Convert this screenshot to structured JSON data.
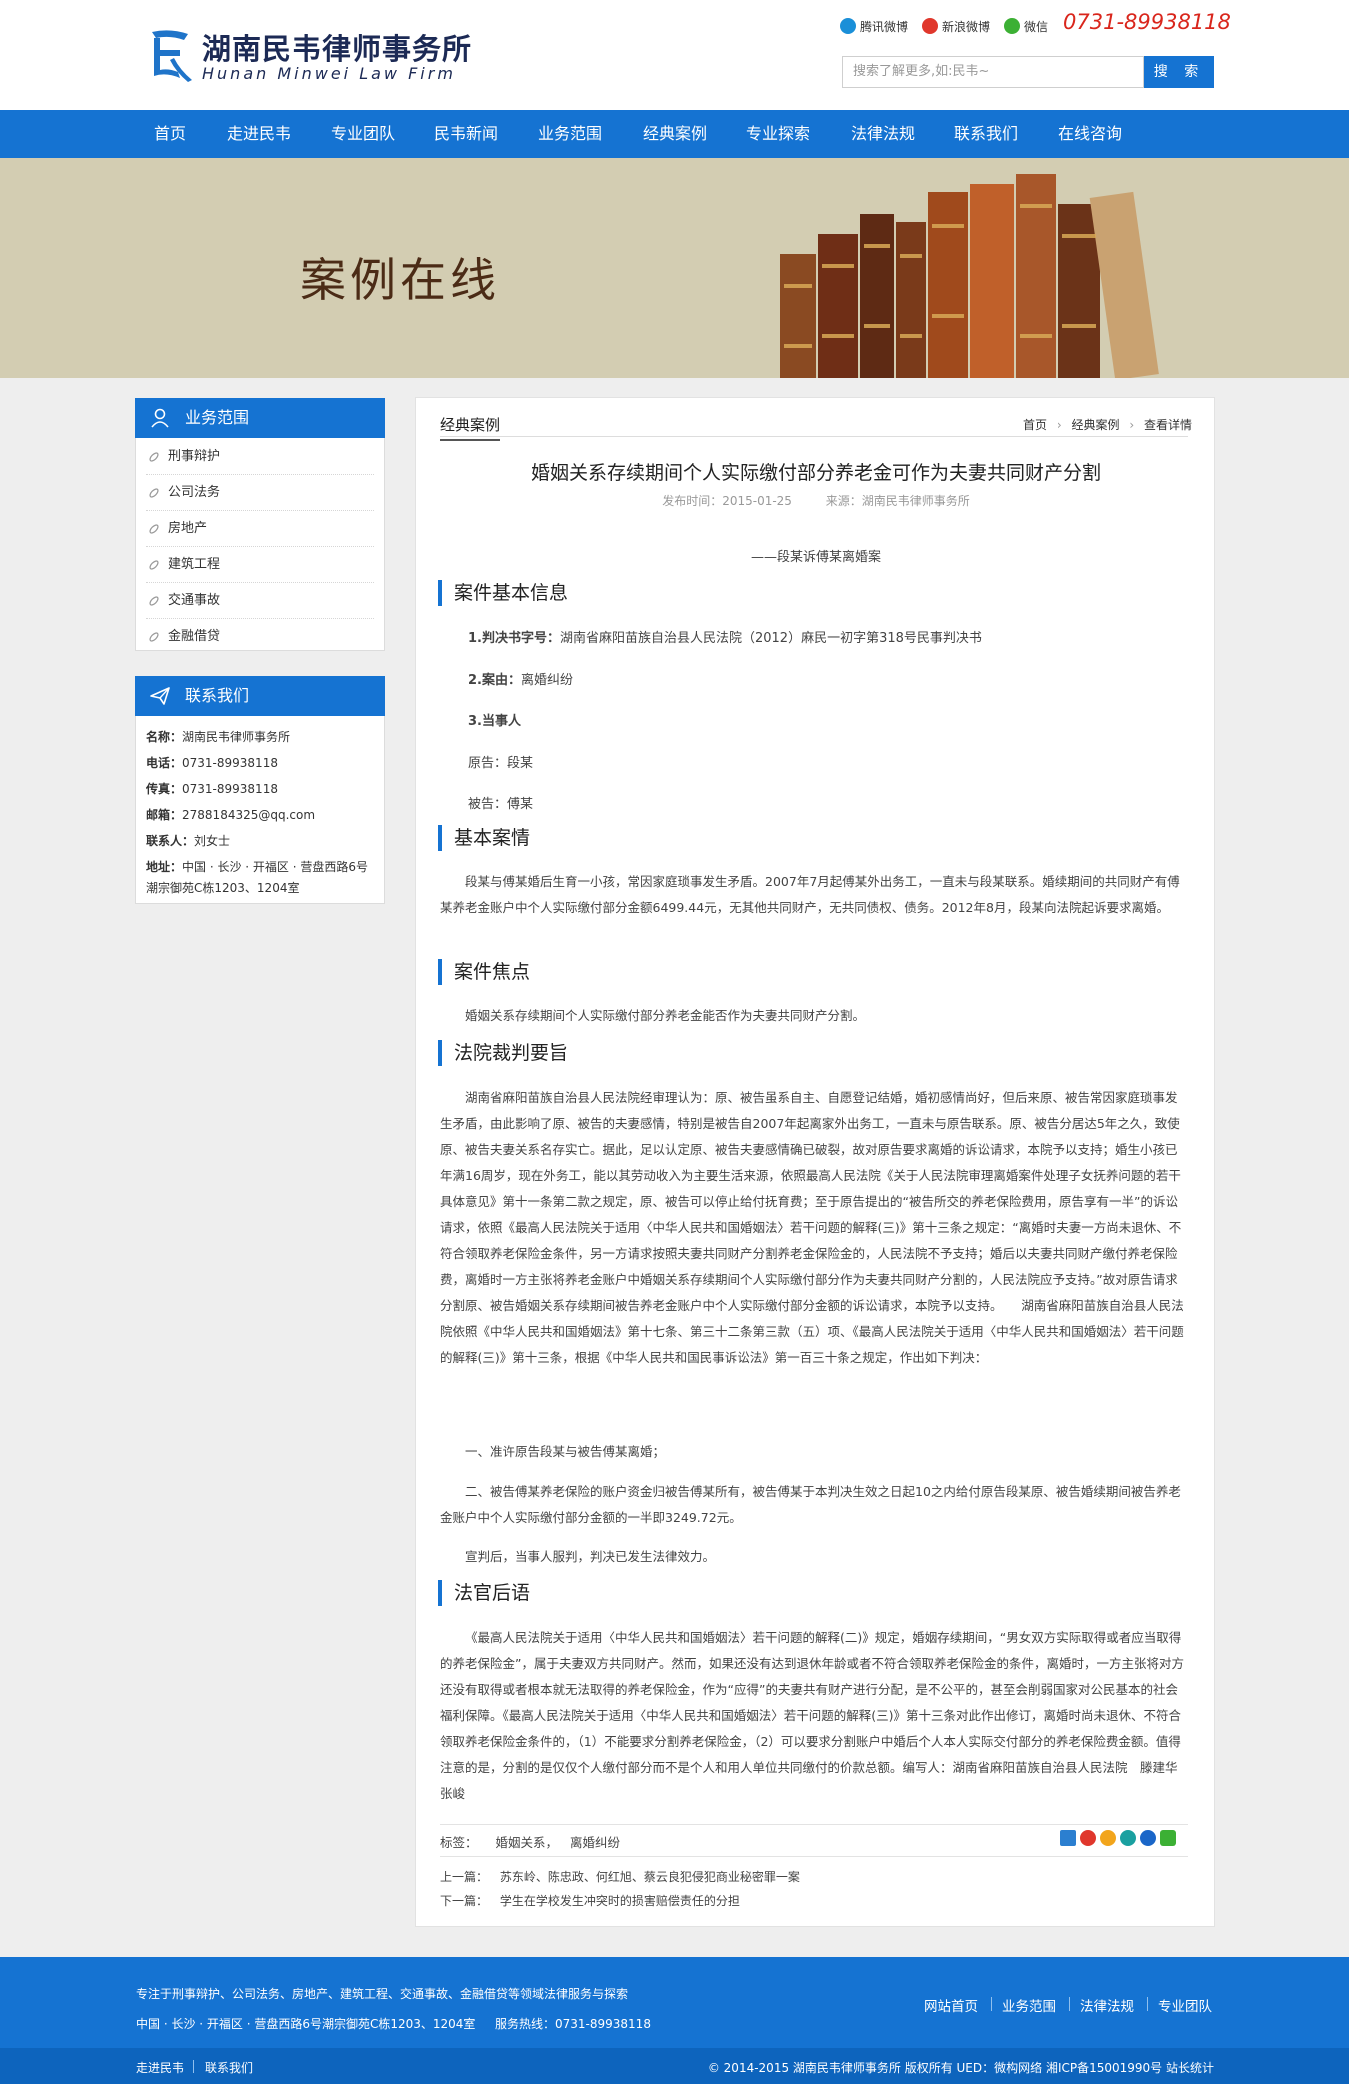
{
  "header": {
    "logo_cn": "湖南民韦律师事务所",
    "logo_en": "Hunan Minwei Law Firm",
    "social": [
      {
        "label": "腾讯微博",
        "icon": "tencent-weibo-icon",
        "color": "#1a8fd8"
      },
      {
        "label": "新浪微博",
        "icon": "sina-weibo-icon",
        "color": "#e0372c"
      },
      {
        "label": "微信",
        "icon": "wechat-icon",
        "color": "#3cb034"
      }
    ],
    "phone": "0731-89938118",
    "search_placeholder": "搜索了解更多,如:民韦~",
    "search_button": "搜 索"
  },
  "nav": [
    "首页",
    "走进民韦",
    "专业团队",
    "民韦新闻",
    "业务范围",
    "经典案例",
    "专业探索",
    "法律法规",
    "联系我们",
    "在线咨询"
  ],
  "banner": {
    "title": "案例在线"
  },
  "sidebar": {
    "categories_title": "业务范围",
    "categories": [
      "刑事辩护",
      "公司法务",
      "房地产",
      "建筑工程",
      "交通事故",
      "金融借贷"
    ],
    "contact_title": "联系我们",
    "contact": [
      {
        "label": "名称：",
        "value": "湖南民韦律师事务所"
      },
      {
        "label": "电话：",
        "value": "0731-89938118"
      },
      {
        "label": "传真：",
        "value": "0731-89938118"
      },
      {
        "label": "邮箱：",
        "value": "2788184325@qq.com"
      },
      {
        "label": "联系人：",
        "value": "刘女士"
      },
      {
        "label": "地址：",
        "value": "中国 · 长沙 · 开福区 · 营盘西路6号"
      }
    ],
    "contact_address_2": "潮宗御苑C栋1203、1204室"
  },
  "article": {
    "section": "经典案例",
    "breadcrumb": [
      "首页",
      "经典案例",
      "查看详情"
    ],
    "title": "婚姻关系存续期间个人实际缴付部分养老金可作为夫妻共同财产分割",
    "publish": "发布时间：2015-01-25",
    "source": "来源：湖南民韦律师事务所",
    "subtitle": "——段某诉傅某离婚案",
    "headings": [
      "案件基本信息",
      "基本案情",
      "案件焦点",
      "法院裁判要旨",
      "法官后语"
    ],
    "info": [
      {
        "label": "1.判决书字号：",
        "value": "湖南省麻阳苗族自治县人民法院（2012）麻民一初字第318号民事判决书"
      },
      {
        "label": "2.案由：",
        "value": "离婚纠纷"
      },
      {
        "label": "3.当事人",
        "value": ""
      }
    ],
    "plaintiff": "原告：段某",
    "defendant": "被告：傅某",
    "facts": "段某与傅某婚后生育一小孩，常因家庭琐事发生矛盾。2007年7月起傅某外出务工，一直未与段某联系。婚续期间的共同财产有傅某养老金账户中个人实际缴付部分金额6499.44元，无其他共同财产，无共同债权、债务。2012年8月，段某向法院起诉要求离婚。",
    "focus": "婚姻关系存续期间个人实际缴付部分养老金能否作为夫妻共同财产分割。",
    "ruling": "湖南省麻阳苗族自治县人民法院经审理认为：原、被告虽系自主、自愿登记结婚，婚初感情尚好，但后来原、被告常因家庭琐事发生矛盾，由此影响了原、被告的夫妻感情，特别是被告自2007年起离家外出务工，一直未与原告联系。原、被告分居达5年之久，致使原、被告夫妻关系名存实亡。据此，足以认定原、被告夫妻感情确已破裂，故对原告要求离婚的诉讼请求，本院予以支持；婚生小孩已年满16周岁，现在外务工，能以其劳动收入为主要生活来源，依照最高人民法院《关于人民法院审理离婚案件处理子女抚养问题的若干具体意见》第十一条第二款之规定，原、被告可以停止给付抚育费；至于原告提出的“被告所交的养老保险费用，原告享有一半”的诉讼请求，依照《最高人民法院关于适用〈中华人民共和国婚姻法〉若干问题的解释(三)》第十三条之规定：“离婚时夫妻一方尚未退休、不符合领取养老保险金条件，另一方请求按照夫妻共同财产分割养老金保险金的，人民法院不予支持；婚后以夫妻共同财产缴付养老保险费，离婚时一方主张将养老金账户中婚姻关系存续期间个人实际缴付部分作为夫妻共同财产分割的，人民法院应予支持。”故对原告请求分割原、被告婚姻关系存续期间被告养老金账户中个人实际缴付部分金额的诉讼请求，本院予以支持。　　湖南省麻阳苗族自治县人民法院依照《中华人民共和国婚姻法》第十七条、第三十二条第三款（五）项、《最高人民法院关于适用〈中华人民共和国婚姻法〉若干问题的解释(三)》第十三条，根据《中华人民共和国民事诉讼法》第一百三十条之规定，作出如下判决：",
    "verdict1": "一、准许原告段某与被告傅某离婚；",
    "verdict2": "二、被告傅某养老保险的账户资金归被告傅某所有，被告傅某于本判决生效之日起10之内给付原告段某原、被告婚续期间被告养老金账户中个人实际缴付部分金额的一半即3249.72元。",
    "verdict3": "宣判后，当事人服判，判决已发生法律效力。",
    "afterword": "《最高人民法院关于适用〈中华人民共和国婚姻法〉若干问题的解释(二)》规定，婚姻存续期间，“男女双方实际取得或者应当取得的养老保险金”，属于夫妻双方共同财产。然而，如果还没有达到退休年龄或者不符合领取养老保险金的条件，离婚时，一方主张将对方还没有取得或者根本就无法取得的养老保险金，作为“应得”的夫妻共有财产进行分配，是不公平的，甚至会削弱国家对公民基本的社会福利保障。《最高人民法院关于适用〈中华人民共和国婚姻法〉若干问题的解释(三)》第十三条对此作出修订，离婚时尚未退休、不符合领取养老保险金条件的，（1）不能要求分割养老保险金，（2）可以要求分割账户中婚后个人本人实际交付部分的养老保险费金额。值得注意的是，分割的是仅仅个人缴付部分而不是个人和用人单位共同缴付的价款总额。编写人：湖南省麻阳苗族自治县人民法院　滕建华　张峻",
    "tags_label": "标签：",
    "tags": [
      "婚姻关系，",
      "离婚纠纷"
    ],
    "prev_label": "上一篇：",
    "prev": "苏东岭、陈忠政、何红旭、蔡云良犯侵犯商业秘密罪一案",
    "next_label": "下一篇：",
    "next": "学生在学校发生冲突时的损害赔偿责任的分担",
    "share_icons": [
      {
        "icon": "share-plus-icon",
        "color": "#2b7fd0"
      },
      {
        "icon": "sina-weibo-share-icon",
        "color": "#e0372c"
      },
      {
        "icon": "qzone-share-icon",
        "color": "#f2a51c"
      },
      {
        "icon": "pinterest-share-icon",
        "color": "#1aa0a0"
      },
      {
        "icon": "renren-share-icon",
        "color": "#1a66c8"
      },
      {
        "icon": "wechat-share-icon",
        "color": "#3cb034"
      }
    ]
  },
  "footer": {
    "desc": "专注于刑事辩护、公司法务、房地产、建筑工程、交通事故、金融借贷等领域法律服务与探索",
    "address": "中国 · 长沙 · 开福区 · 营盘西路6号潮宗御苑C栋1203、1204室",
    "hotline": "服务热线：0731-89938118",
    "links": [
      "网站首页",
      "业务范围",
      "法律法规",
      "专业团队"
    ],
    "bottom_links": [
      "走进民韦",
      "联系我们"
    ],
    "copyright": "© 2014-2015 湖南民韦律师事务所 版权所有 UED：微构网络  湘ICP备15001990号 站长统计"
  },
  "colors": {
    "brand_blue": "#1573d2",
    "banner_bg": "#d3cdb2",
    "phone_red": "#d9261c"
  }
}
